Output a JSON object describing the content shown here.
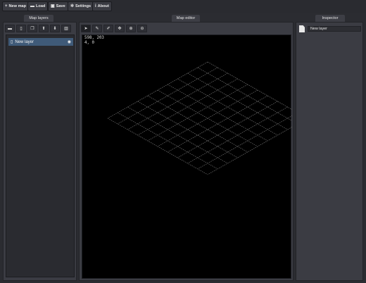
{
  "menu": [
    {
      "icon": "+",
      "icon_name": "plus-icon",
      "label": "New map"
    },
    {
      "icon": "▬",
      "icon_name": "folder-icon",
      "label": "Load"
    },
    {
      "icon": "▣",
      "icon_name": "save-icon",
      "label": "Save"
    },
    {
      "icon": "✲",
      "icon_name": "gear-icon",
      "label": "Settings"
    },
    {
      "icon": "i",
      "icon_name": "info-icon",
      "label": "About"
    }
  ],
  "panels": {
    "layers_title": "Map layers",
    "editor_title": "Map editor",
    "inspector_title": "Inspector"
  },
  "layer_tools": [
    {
      "icon": "▬",
      "icon_name": "folder-icon"
    },
    {
      "icon": "▯",
      "icon_name": "new-file-icon"
    },
    {
      "icon": "❐",
      "icon_name": "copy-icon"
    },
    {
      "icon": "⬆",
      "icon_name": "arrow-up-icon"
    },
    {
      "icon": "⬇",
      "icon_name": "arrow-down-icon"
    },
    {
      "icon": "▥",
      "icon_name": "trash-icon"
    }
  ],
  "editor_tools": [
    {
      "icon": "➤",
      "icon_name": "cursor-icon",
      "active": true
    },
    {
      "icon": "✎",
      "icon_name": "pencil-icon"
    },
    {
      "icon": "✐",
      "icon_name": "eraser-icon"
    },
    {
      "icon": "✥",
      "icon_name": "move-icon"
    },
    {
      "icon": "⊕",
      "icon_name": "zoom-in-icon"
    },
    {
      "icon": "⊖",
      "icon_name": "zoom-out-icon"
    }
  ],
  "layers": [
    {
      "name": "New layer",
      "visible": true,
      "selected": true
    }
  ],
  "editor": {
    "cursor_pixel": "598, 203",
    "cursor_tile": "4, 0",
    "grid_columns": 10,
    "grid_rows": 10
  },
  "inspector": {
    "layer_name": "New layer"
  },
  "colors": {
    "selected_layer": "#3f5a78",
    "grid_line": "#6e6e6e"
  }
}
